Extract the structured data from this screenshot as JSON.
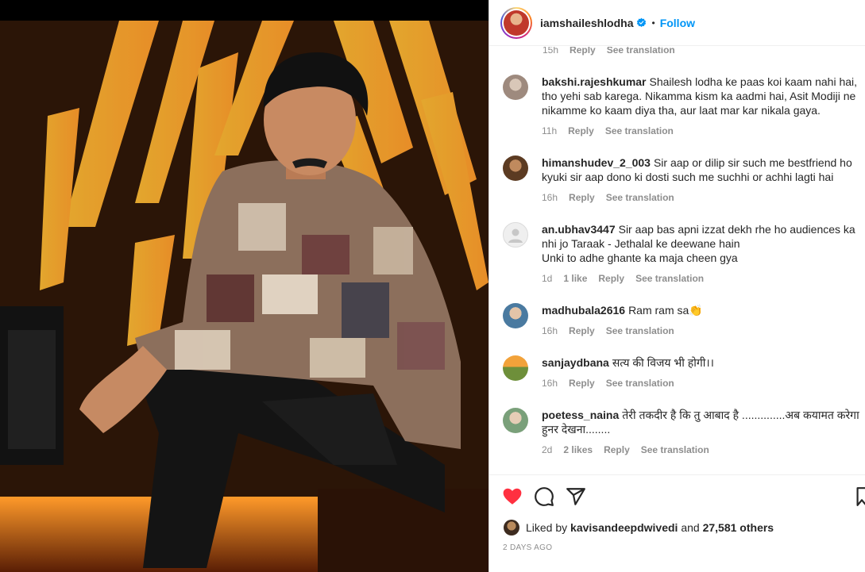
{
  "header": {
    "username": "iamshaileshlodha",
    "verified": true,
    "separator": "•",
    "follow_label": "Follow",
    "more_label": "..."
  },
  "previous_comment_meta": {
    "time": "15h",
    "reply": "Reply",
    "translation": "See translation"
  },
  "comments": [
    {
      "username": "bakshi.rajeshkumar",
      "text": "Shailesh lodha ke paas koi kaam nahi hai, tho yehi sab karega. Nikamma kism ka aadmi hai, Asit Modiji ne nikamme ko kaam diya tha, aur laat mar kar nikala gaya.",
      "time": "11h",
      "likes": "",
      "reply": "Reply",
      "translation": "See translation"
    },
    {
      "username": "himanshudev_2_003",
      "text": "Sir aap or dilip sir such me bestfriend ho kyuki sir aap dono ki dosti such me suchhi or achhi lagti hai",
      "time": "16h",
      "likes": "",
      "reply": "Reply",
      "translation": "See translation"
    },
    {
      "username": "an.ubhav3447",
      "text": "Sir aap bas apni izzat dekh rhe ho audiences ka nhi jo Taraak - Jethalal ke deewane hain\nUnki to adhe ghante ka maja cheen gya",
      "time": "1d",
      "likes": "1 like",
      "reply": "Reply",
      "translation": "See translation"
    },
    {
      "username": "madhubala2616",
      "text": "Ram ram sa👏",
      "time": "16h",
      "likes": "",
      "reply": "Reply",
      "translation": "See translation"
    },
    {
      "username": "sanjaydbana",
      "text": "सत्य की विजय भी होगी।।",
      "time": "16h",
      "likes": "",
      "reply": "Reply",
      "translation": "See translation"
    },
    {
      "username": "poetess_naina",
      "text": "तेरी तकदीर है कि तु आबाद है ..............अब कयामत करेगा हुनर देखना........",
      "time": "2d",
      "likes": "2 likes",
      "reply": "Reply",
      "translation": "See translation"
    }
  ],
  "actions": {
    "like_icon": "heart-filled-icon",
    "comment_icon": "comment-icon",
    "share_icon": "share-icon",
    "save_icon": "bookmark-icon",
    "like_color": "#ff3040"
  },
  "likes": {
    "prefix": "Liked by",
    "user": "kavisandeepdwivedi",
    "joiner": "and",
    "count": "27,581 others"
  },
  "posted": "2 DAYS AGO"
}
